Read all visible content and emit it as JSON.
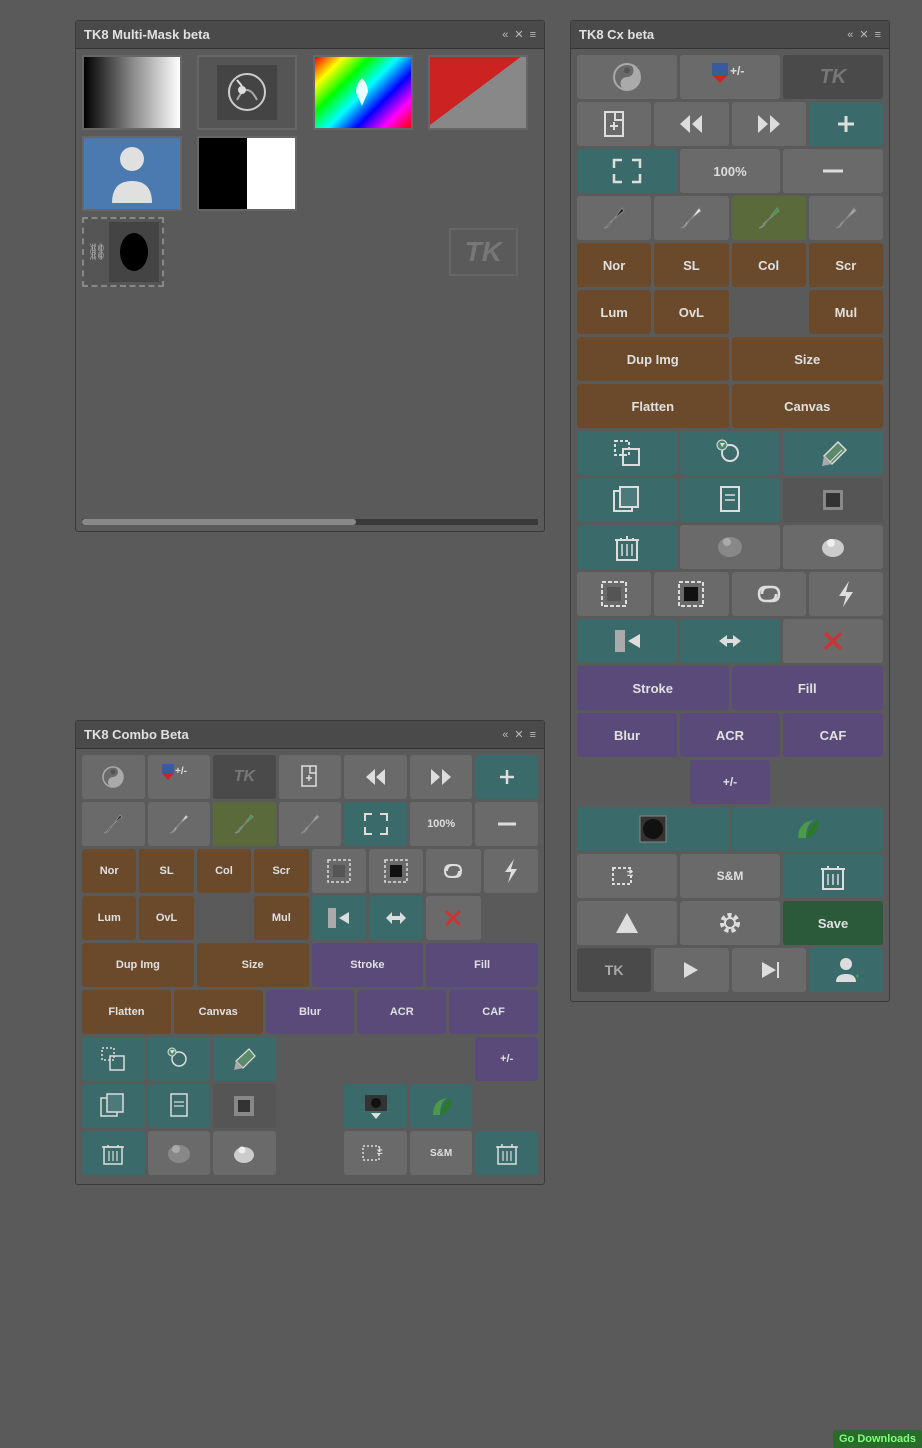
{
  "panels": {
    "multimask": {
      "title": "TK8 Multi-Mask beta",
      "header_arrows": "«",
      "header_close": "✕",
      "header_menu": "≡",
      "tk_placeholder": "TK",
      "thumbs_row1": [
        {
          "label": "bw-gradient",
          "type": "bw-gradient"
        },
        {
          "label": "curves",
          "type": "curves"
        },
        {
          "label": "hue",
          "type": "hue"
        },
        {
          "label": "reddark",
          "type": "reddark"
        }
      ],
      "thumbs_row2": [
        {
          "label": "person",
          "type": "person"
        },
        {
          "label": "blackwhite",
          "type": "blackwhite"
        }
      ]
    },
    "cx": {
      "title": "TK8 Cx beta",
      "header_arrows": "«",
      "header_close": "✕",
      "header_menu": "≡",
      "rows": [
        {
          "type": "buttons-4",
          "buttons": [
            {
              "label": "+/-",
              "style": "c-gray",
              "icon": "plusminus"
            },
            {
              "label": "",
              "style": "c-gray",
              "icon": "flag-icon"
            },
            {
              "label": "TK",
              "style": "c-dark",
              "icon": "tk-italic"
            }
          ]
        }
      ],
      "btn_plusminus": "+/-",
      "btn_tk_italic": "TK",
      "btn_100pct": "100%",
      "blend_nor": "Nor",
      "blend_sl": "SL",
      "blend_col": "Col",
      "blend_scr": "Scr",
      "blend_lum": "Lum",
      "blend_ovl": "OvL",
      "blend_mul": "Mul",
      "btn_dup_img": "Dup Img",
      "btn_size": "Size",
      "btn_flatten": "Flatten",
      "btn_canvas": "Canvas",
      "btn_stroke": "Stroke",
      "btn_fill": "Fill",
      "btn_blur": "Blur",
      "btn_acr": "ACR",
      "btn_caf": "CAF",
      "btn_sm": "S&M",
      "btn_save": "Save",
      "btn_plus_minus_bottom": "+/-"
    },
    "combo": {
      "title": "TK8 Combo Beta",
      "header_arrows": "«",
      "header_close": "✕",
      "header_menu": "≡",
      "btn_plusminus": "+/-",
      "btn_tk_italic": "TK",
      "btn_100pct": "100%",
      "blend_nor": "Nor",
      "blend_sl": "SL",
      "blend_col": "Col",
      "blend_scr": "Scr",
      "blend_lum": "Lum",
      "blend_ovl": "OvL",
      "blend_mul": "Mul",
      "btn_dup_img": "Dup Img",
      "btn_size": "Size",
      "btn_flatten": "Flatten",
      "btn_canvas": "Canvas",
      "btn_stroke": "Stroke",
      "btn_fill": "Fill",
      "btn_blur": "Blur",
      "btn_acr": "ACR",
      "btn_caf": "CAF",
      "btn_plus_minus": "+/-",
      "btn_sm": "S&M"
    }
  },
  "watermark": {
    "text": "Go Downloads",
    "bg_color": "#2a6a2a",
    "text_color": "#7fff7f"
  }
}
